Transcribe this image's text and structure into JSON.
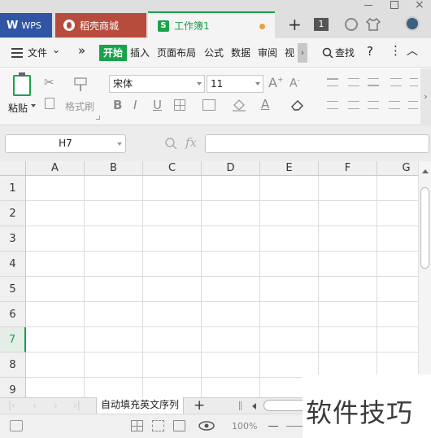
{
  "titlebar": {
    "tabs": [
      {
        "label": "WPS",
        "icon": "wps-logo-icon"
      },
      {
        "label": "稻壳商城",
        "icon": "docer-icon"
      },
      {
        "label": "工作簿1",
        "icon": "spreadsheet-icon",
        "modified": true
      }
    ],
    "new_tab": "+",
    "page_count": "1"
  },
  "menu": {
    "file": "文件",
    "more": "»",
    "tabs": [
      "开始",
      "插入",
      "页面布局",
      "公式",
      "数据",
      "审阅",
      "视"
    ],
    "active_tab": "开始",
    "search": "查找",
    "help": "?"
  },
  "ribbon": {
    "paste": "粘贴",
    "format_painter": "格式刷",
    "font_name": "宋体",
    "font_size": "11"
  },
  "formula_bar": {
    "name_box": "H7",
    "fx": "fx",
    "value": ""
  },
  "grid": {
    "columns": [
      "A",
      "B",
      "C",
      "D",
      "E",
      "F",
      "G"
    ],
    "rows": [
      "1",
      "2",
      "3",
      "4",
      "5",
      "6",
      "7",
      "8",
      "9"
    ],
    "active_row": "7"
  },
  "sheets": {
    "tabs": [
      "自动填充英文序列"
    ],
    "add": "+"
  },
  "status": {
    "zoom": "100%"
  },
  "watermark": "软件技巧",
  "colors": {
    "accent_green": "#1aa34a",
    "wps_blue": "#2f55a4",
    "docer_red": "#b84c3c"
  }
}
